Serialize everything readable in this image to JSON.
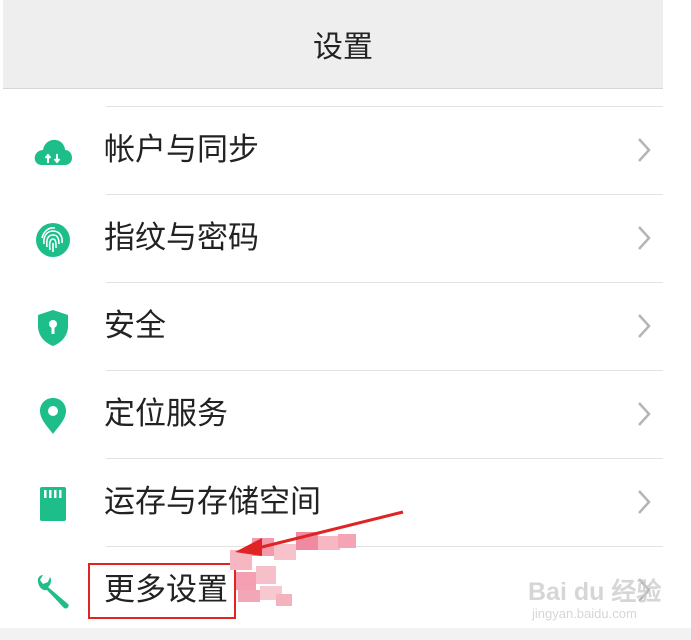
{
  "header": {
    "title": "设置"
  },
  "menu": {
    "items": [
      {
        "label": "帐户与同步",
        "icon": "cloud-sync-icon"
      },
      {
        "label": "指纹与密码",
        "icon": "fingerprint-icon"
      },
      {
        "label": "安全",
        "icon": "shield-icon"
      },
      {
        "label": "定位服务",
        "icon": "location-pin-icon"
      },
      {
        "label": "运存与存储空间",
        "icon": "sd-card-icon"
      },
      {
        "label": "更多设置",
        "icon": "wrench-icon"
      }
    ]
  },
  "colors": {
    "accent": "#1ebe8a",
    "annotation": "#e02424",
    "header_bg": "#eeeeee"
  },
  "watermark": {
    "logo": "Bai du 经验",
    "url": "jingyan.baidu.com"
  }
}
